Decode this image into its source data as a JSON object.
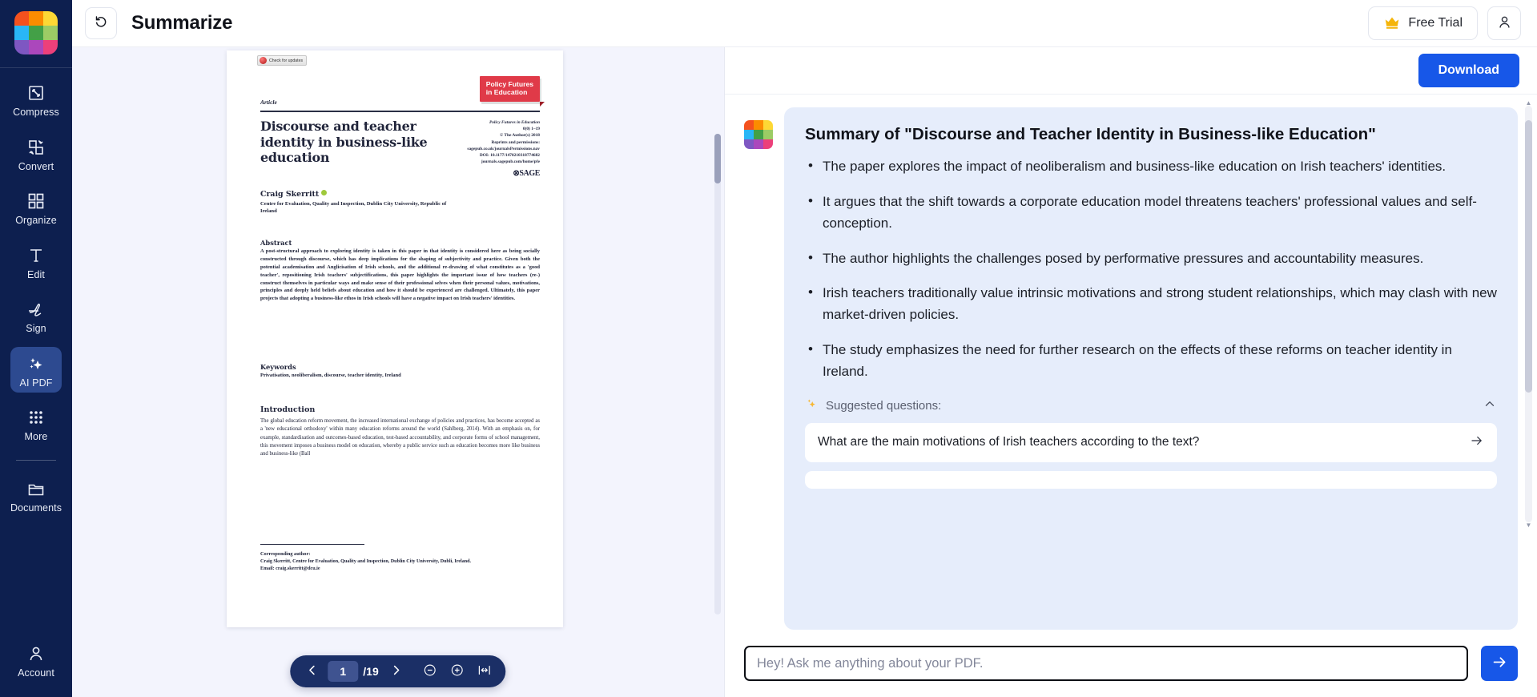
{
  "app": {
    "logo_colors": [
      "#f4511e",
      "#fb8c00",
      "#fdd835",
      "#29b6f6",
      "#43a047",
      "#9ccc65",
      "#7e57c2",
      "#ab47bc",
      "#ec407a"
    ]
  },
  "sidebar": {
    "items": [
      {
        "label": "Compress",
        "icon": "compress-icon",
        "active": false
      },
      {
        "label": "Convert",
        "icon": "convert-icon",
        "active": false
      },
      {
        "label": "Organize",
        "icon": "organize-icon",
        "active": false
      },
      {
        "label": "Edit",
        "icon": "edit-text-icon",
        "active": false
      },
      {
        "label": "Sign",
        "icon": "signature-icon",
        "active": false
      },
      {
        "label": "AI PDF",
        "icon": "sparkles-icon",
        "active": true
      },
      {
        "label": "More",
        "icon": "grid-dots-icon",
        "active": false
      },
      {
        "label": "Documents",
        "icon": "folder-icon",
        "active": false
      }
    ],
    "account_label": "Account",
    "account_icon": "user-icon"
  },
  "topbar": {
    "back_icon": "undo-arrow-icon",
    "title": "Summarize",
    "trial_label": "Free Trial",
    "crown_icon": "crown-icon",
    "account_icon": "user-outline-icon"
  },
  "viewer": {
    "toolbar": {
      "prev_icon": "chevron-left-icon",
      "next_icon": "chevron-right-icon",
      "zoom_out_icon": "minus-circle-icon",
      "zoom_in_icon": "plus-circle-icon",
      "fit_width_icon": "fit-width-icon",
      "current_page": "1",
      "total_pages": "/19"
    },
    "pdf": {
      "check_updates": "Check for updates",
      "journal_badge": "Policy Futures\nin Education",
      "article_label": "Article",
      "title": "Discourse and teacher identity in business-like education",
      "imprint": [
        "Policy Futures in Education",
        "0(0) 1–19",
        "© The Author(s) 2018",
        "Reprints and permissions:",
        "sagepub.co.uk/journalsPermissions.nav",
        "DOI: 10.1177/1478210318774682",
        "journals.sagepub.com/home/pfe"
      ],
      "publisher": "⊗SAGE",
      "author": "Craig Skerritt",
      "affiliation": "Centre for Evaluation, Quality and Inspection, Dublin City University, Republic of Ireland",
      "abstract_heading": "Abstract",
      "abstract_body": "A post-structural approach to exploring identity is taken in this paper in that identity is considered here as being socially constructed through discourse, which has deep implications for the shaping of subjectivity and practice. Given both the potential academisation and Anglicisation of Irish schools, and the additional re-drawing of what constitutes as a 'good teacher', repositioning Irish teachers' subjectifications, this paper highlights the important issue of how teachers (re-) construct themselves in particular ways and make sense of their professional selves when their personal values, motivations, principles and deeply held beliefs about education and how it should be experienced are challenged. Ultimately, this paper projects that adopting a business-like ethos in Irish schools will have a negative impact on Irish teachers' identities.",
      "keywords_heading": "Keywords",
      "keywords_body": "Privatisation, neoliberalism, discourse, teacher identity, Ireland",
      "introduction_heading": "Introduction",
      "introduction_body": "The global education reform movement, the increased international exchange of policies and practices, has become accepted as a 'new educational orthodoxy' within many education reforms around the world (Sahlberg, 2014). With an emphasis on, for example, standardisation and outcomes-based education, test-based accountability, and corporate forms of school management, this movement imposes a business model on education, whereby a public service such as education becomes more like business and business-like (Ball",
      "corresponding_heading": "Corresponding author:",
      "corresponding_body": "Craig Skerritt, Centre for Evaluation, Quality and Inspection, Dublin City University, Dubli, Ireland.",
      "corresponding_email": "Email: craig.skerritt@dcu.ie"
    }
  },
  "chat": {
    "download_label": "Download",
    "summary_title": "Summary of \"Discourse and Teacher Identity in Business-like Education\"",
    "summary_points": [
      "The paper explores the impact of neoliberalism and business-like education on Irish teachers' identities.",
      "It argues that the shift towards a corporate education model threatens teachers' professional values and self-conception.",
      "The author highlights the challenges posed by performative pressures and accountability measures.",
      "Irish teachers traditionally value intrinsic motivations and strong student relationships, which may clash with new market-driven policies.",
      "The study emphasizes the need for further research on the effects of these reforms on teacher identity in Ireland."
    ],
    "suggested_heading": "Suggested questions:",
    "suggested_icon": "sparkles-icon",
    "collapse_icon": "chevron-up-icon",
    "suggested_questions": [
      "What are the main motivations of Irish teachers according to the text?",
      ""
    ],
    "input_placeholder": "Hey! Ask me anything about your PDF.",
    "input_value": "",
    "send_icon": "arrow-right-icon"
  },
  "colors": {
    "rail_bg": "#0d1f4f",
    "accent_blue": "#1757e8",
    "bubble_bg": "#e6edfb",
    "viewer_bg": "#f3f4fd",
    "badge_red": "#e03a48",
    "crown_yellow": "#f5b50a"
  }
}
